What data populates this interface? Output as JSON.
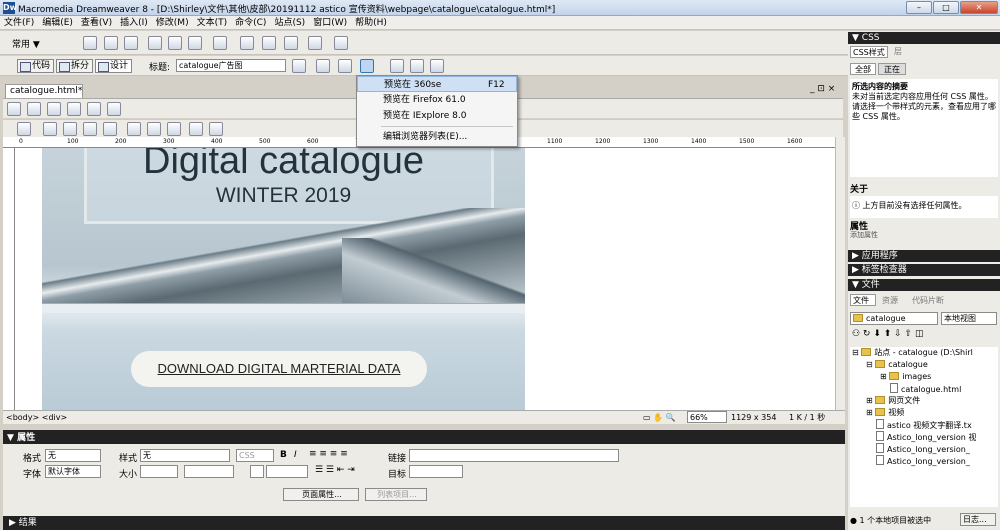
{
  "window": {
    "title": "Macromedia Dreamweaver 8 - [D:\\Shirley\\文件\\其他\\皮部\\20191112 astico 宣传资料\\webpage\\catalogue\\catalogue.html*]",
    "min": "–",
    "max": "□",
    "close": "✕"
  },
  "menu": [
    "文件(F)",
    "编辑(E)",
    "查看(V)",
    "插入(I)",
    "修改(M)",
    "文本(T)",
    "命令(C)",
    "站点(S)",
    "窗口(W)",
    "帮助(H)"
  ],
  "toolbar": {
    "category": "常用 ▼"
  },
  "viewbar": {
    "code": "代码",
    "split": "拆分",
    "design": "设计",
    "title_label": "标题:",
    "title_value": "catalogue广告图"
  },
  "document": {
    "tab": "catalogue.html*",
    "heading": "Digital catalogue",
    "subheading": "WINTER 2019",
    "download": "DOWNLOAD DIGITAL MARTERIAL DATA"
  },
  "preview_menu": [
    {
      "label": "预览在 360se",
      "shortcut": "F12"
    },
    {
      "label": "预览在 Firefox 61.0",
      "shortcut": ""
    },
    {
      "label": "预览在 IExplore 8.0",
      "shortcut": ""
    },
    {
      "label": "编辑浏览器列表(E)...",
      "shortcut": ""
    }
  ],
  "ruler": [
    "0",
    "100",
    "200",
    "300",
    "400",
    "500",
    "600",
    "700",
    "800",
    "900",
    "1000",
    "1100",
    "1200",
    "1300",
    "1400",
    "1500",
    "1600",
    "1700",
    "1800"
  ],
  "status": {
    "tags": "<body> <div>",
    "zoom": "66%",
    "size": "1129 x 354",
    "weight": "1 K / 1 秒"
  },
  "properties": {
    "header": "属性",
    "format_label": "格式",
    "format_value": "无",
    "style_label": "样式",
    "style_value": "无",
    "css": "CSS",
    "bold": "B",
    "italic": "I",
    "font_label": "字体",
    "font_value": "默认字体",
    "size_label": "大小",
    "link_label": "链接",
    "target_label": "目标",
    "page_props": "页面属性...",
    "list_item": "列表项目..."
  },
  "results": "结果",
  "css_panel": {
    "header": "CSS",
    "tab": "CSS样式",
    "tab2": "层",
    "all": "全部",
    "current": "正在",
    "summary_title": "所选内容的摘要",
    "summary_text": "未对当前选定内容应用任何 CSS 属性。请选择一个带样式的元素，查看应用了哪些 CSS 属性。",
    "about": "关于",
    "about_text": "上方目前没有选择任何属性。",
    "attrs": "属性",
    "add_attr": "添加属性"
  },
  "app_panel": "应用程序",
  "tag_panel": "标签检查器",
  "files_panel": {
    "header": "文件",
    "tabs": [
      "文件",
      "资源",
      "代码片断"
    ],
    "site": "catalogue",
    "view": "本地视图",
    "tree": [
      "站点 - catalogue (D:\\Shirl",
      "catalogue",
      "images",
      "catalogue.html",
      "网页文件",
      "视频",
      "astico 视频文字翻译.tx",
      "Astico_long_version 视",
      "Astico_long_version_",
      "Astico_long_version_"
    ],
    "status": "1 个本地项目被选中",
    "log": "日志..."
  }
}
